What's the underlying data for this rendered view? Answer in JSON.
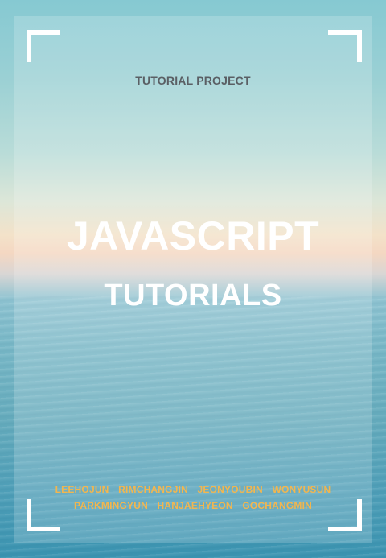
{
  "cover": {
    "kicker": "TUTORIAL PROJECT",
    "title": "JAVASCRIPT",
    "subtitle": "TUTORIALS",
    "authors_row_1": [
      "LEEHOJUN",
      "RIMCHANGJIN",
      "JEONYOUBIN",
      "WONYUSUN"
    ],
    "authors_row_2": [
      "PARKMINGYUN",
      "HANJAEHYEON",
      "GOCHANGMIN"
    ]
  },
  "colors": {
    "title": "#ffffff",
    "kicker": "#5a5f64",
    "authors": "#f2b64f",
    "frame": "#ffffff"
  }
}
